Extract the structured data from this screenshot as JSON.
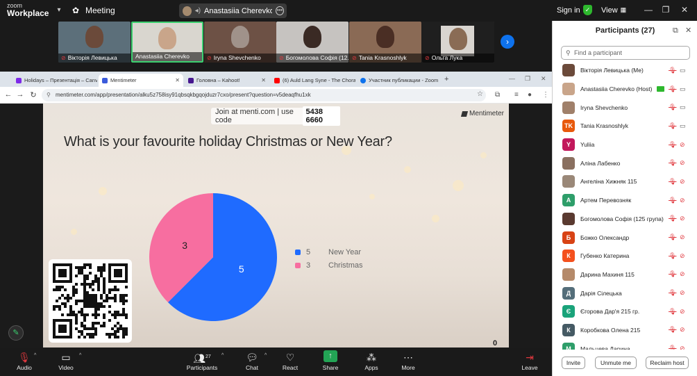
{
  "topbar": {
    "logo_line1": "zoom",
    "logo_line2": "Workplace",
    "meeting_label": "Meeting",
    "share_label": "Anastasiia Cherevko's screen",
    "signin_label": "Sign in",
    "view_label": "View"
  },
  "strip": {
    "tiles": [
      {
        "name": "Вікторія Левицька",
        "face": "#6b4a3a",
        "bg": "#5c6f7a"
      },
      {
        "name": "Anastasiia Cherevko",
        "face": "#c9a58a",
        "bg": "#d9d6cf"
      },
      {
        "name": "Iryna Shevchenko",
        "face": "#a0928a",
        "bg": "#6d5145"
      },
      {
        "name": "Богомолова Софія (12...",
        "face": "#3a2a24",
        "bg": "#c6c3c0"
      },
      {
        "name": "Tania Krasnoshlyk",
        "face": "#4a2e24",
        "bg": "#8a6a55"
      },
      {
        "name": "Ольга Лука",
        "face": "#8a6c55",
        "bg": "#d9d5d0"
      }
    ]
  },
  "browser": {
    "tabs": [
      {
        "label": "Holidays – Презентація – Canva",
        "color": "#7d2ae8"
      },
      {
        "label": "Mentimeter",
        "color": "#3b5bdb"
      },
      {
        "label": "Головна – Kahoot!",
        "color": "#46178f"
      },
      {
        "label": "(6) Auld Lang Syne - The Chora",
        "color": "#ff0000"
      },
      {
        "label": "Участник публикации - Zoom",
        "color": "#0e72ed"
      }
    ],
    "url": "mentimeter.com/app/presentation/alku5z758isy91qbsqkbgqojduzr7cxo/present?question=v5deaqfhu1xk"
  },
  "slide": {
    "join_text": "Join at menti.com | use code",
    "code": "5438 6660",
    "brand": "Mentimeter",
    "question": "What is your favourite holiday Christmas or New Year?",
    "counter": "0"
  },
  "chart_data": {
    "type": "pie",
    "categories": [
      "New Year",
      "Christmas"
    ],
    "values": [
      5,
      3
    ],
    "colors": [
      "#1f6bff",
      "#f76ea0"
    ],
    "legend_position": "right"
  },
  "panel": {
    "title": "Participants (27)",
    "search_placeholder": "Find a participant",
    "participants": [
      {
        "name": "Вікторія Левицька (Me)",
        "avatar_text": "",
        "avatar_color": "#6b4a3a",
        "cam_on": true,
        "host": false
      },
      {
        "name": "Anastasiia Cherevko (Host)",
        "avatar_text": "",
        "avatar_color": "#c9a58a",
        "cam_on": true,
        "host": true
      },
      {
        "name": "Iryna Shevchenko",
        "avatar_text": "",
        "avatar_color": "#a0806a",
        "cam_on": true,
        "host": false
      },
      {
        "name": "Tania Krasnoshlyk",
        "avatar_text": "TK",
        "avatar_color": "#e8590c",
        "cam_on": true,
        "host": false
      },
      {
        "name": "Yuliia",
        "avatar_text": "Y",
        "avatar_color": "#c2185b",
        "cam_on": false,
        "host": false
      },
      {
        "name": "Аліна Лабенко",
        "avatar_text": "",
        "avatar_color": "#8a7060",
        "cam_on": false,
        "host": false
      },
      {
        "name": "Ангеліна Хижняк 115",
        "avatar_text": "",
        "avatar_color": "#9a8878",
        "cam_on": false,
        "host": false
      },
      {
        "name": "Артем Перевозняк",
        "avatar_text": "А",
        "avatar_color": "#2e9e6a",
        "cam_on": false,
        "host": false
      },
      {
        "name": "Богомолова Софія (125 група)",
        "avatar_text": "",
        "avatar_color": "#5a3a30",
        "cam_on": false,
        "host": false
      },
      {
        "name": "Божко Олександр",
        "avatar_text": "Б",
        "avatar_color": "#d84315",
        "cam_on": false,
        "host": false
      },
      {
        "name": "Губенко Катерина",
        "avatar_text": "К",
        "avatar_color": "#f4511e",
        "cam_on": false,
        "host": false
      },
      {
        "name": "Дарина Махиня 115",
        "avatar_text": "",
        "avatar_color": "#b58a6a",
        "cam_on": false,
        "host": false
      },
      {
        "name": "Дарія Сілецька",
        "avatar_text": "Д",
        "avatar_color": "#546e7a",
        "cam_on": false,
        "host": false
      },
      {
        "name": "Єгорова Дар'я 215 гр.",
        "avatar_text": "Є",
        "avatar_color": "#1aa37a",
        "cam_on": false,
        "host": false
      },
      {
        "name": "Коробкова Олена 215",
        "avatar_text": "К",
        "avatar_color": "#455a64",
        "cam_on": false,
        "host": false
      },
      {
        "name": "Мальцева Дарина",
        "avatar_text": "М",
        "avatar_color": "#2e9e6a",
        "cam_on": false,
        "host": false
      }
    ],
    "invite_label": "Invite",
    "unmute_label": "Unmute me",
    "reclaim_label": "Reclaim host"
  },
  "toolbar": {
    "audio": "Audio",
    "video": "Video",
    "participants": "Participants",
    "participants_count": "27",
    "chat": "Chat",
    "react": "React",
    "share": "Share",
    "apps": "Apps",
    "more": "More",
    "leave": "Leave"
  }
}
